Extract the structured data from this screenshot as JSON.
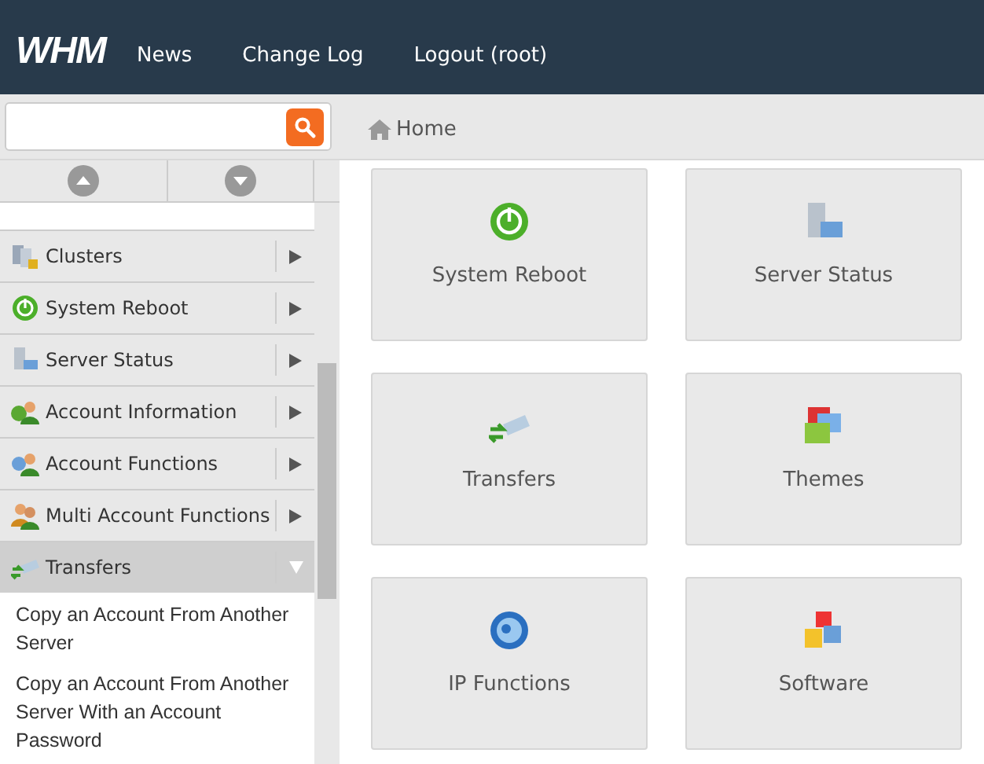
{
  "header": {
    "logo": "WHM",
    "nav": [
      "News",
      "Change Log",
      "Logout (root)"
    ]
  },
  "breadcrumb": [
    "Home"
  ],
  "sidebar": {
    "items": [
      {
        "label": "Clusters",
        "kind": "clusters",
        "selected": false,
        "expanded": false
      },
      {
        "label": "System Reboot",
        "kind": "power",
        "selected": false,
        "expanded": false
      },
      {
        "label": "Server Status",
        "kind": "server",
        "selected": false,
        "expanded": false
      },
      {
        "label": "Account Information",
        "kind": "account-info",
        "selected": false,
        "expanded": false
      },
      {
        "label": "Account Functions",
        "kind": "account-functions",
        "selected": false,
        "expanded": false
      },
      {
        "label": "Multi Account Functions",
        "kind": "multi-account",
        "selected": false,
        "expanded": false
      },
      {
        "label": "Transfers",
        "kind": "transfers",
        "selected": true,
        "expanded": true,
        "children": [
          "Copy an Account From Another Server",
          "Copy an Account From Another Server With an Account Password"
        ]
      }
    ]
  },
  "tiles": [
    {
      "label": "System Reboot",
      "kind": "power"
    },
    {
      "label": "Server Status",
      "kind": "server"
    },
    {
      "label": "Transfers",
      "kind": "transfers"
    },
    {
      "label": "Themes",
      "kind": "themes"
    },
    {
      "label": "IP Functions",
      "kind": "ip"
    },
    {
      "label": "Software",
      "kind": "software"
    }
  ]
}
